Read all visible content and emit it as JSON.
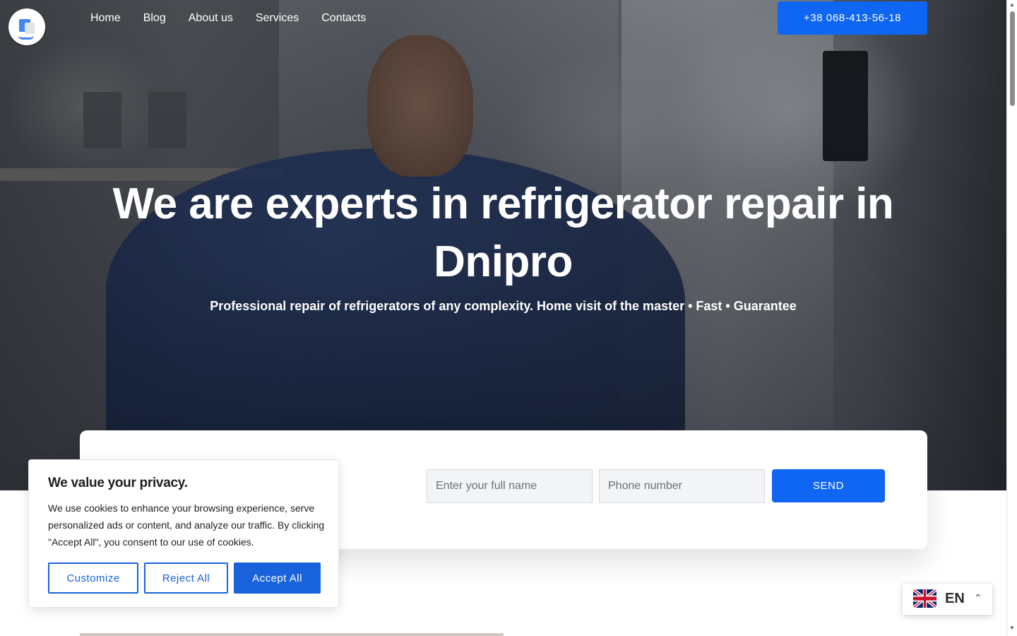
{
  "header": {
    "logo": "translate-logo-icon",
    "nav": [
      "Home",
      "Blog",
      "About us",
      "Services",
      "Contacts"
    ],
    "phone": "+38 068-413-56-18"
  },
  "hero": {
    "title": "We are experts in refrigerator repair in Dnipro",
    "subtitle": "Professional repair of refrigerators of any complexity. Home visit of the master • Fast • Guarantee"
  },
  "form": {
    "name_placeholder": "Enter your full name",
    "phone_placeholder": "Phone number",
    "send_label": "SEND"
  },
  "cookie": {
    "title": "We value your privacy.",
    "text": "We use cookies to enhance your browsing experience, serve personalized ads or content, and analyze our traffic. By clicking \"Accept All\", you consent to our use of cookies.",
    "customize": "Customize",
    "reject": "Reject All",
    "accept": "Accept All"
  },
  "language": {
    "code": "EN",
    "flag": "uk-flag-icon"
  },
  "colors": {
    "accent": "#0f66f2",
    "cookie_accent": "#1863dc"
  }
}
